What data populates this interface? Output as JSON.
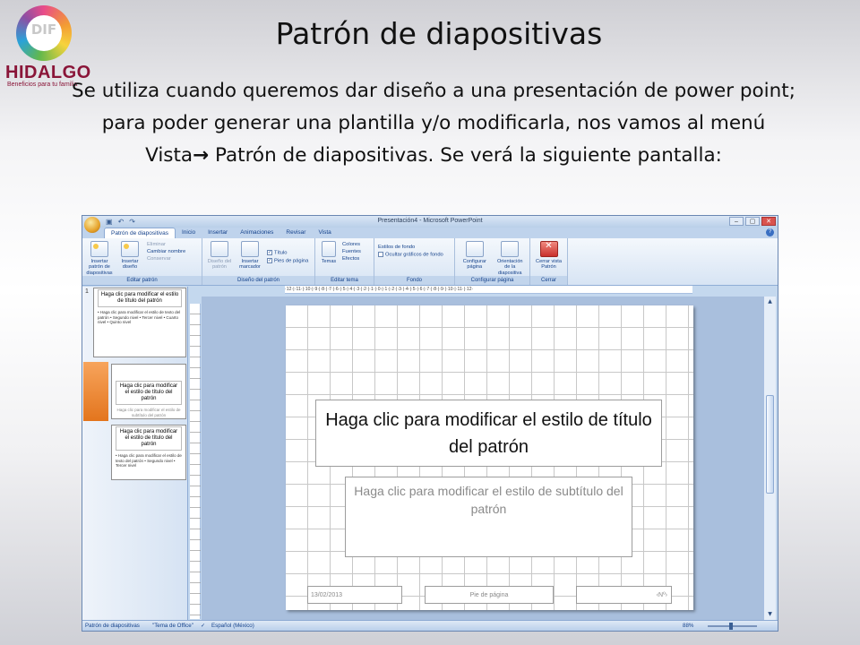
{
  "logo": {
    "mark": "DIF",
    "name": "HIDALGO",
    "tagline": "Beneficios para tu familia"
  },
  "slide_title": "Patrón de diapositivas",
  "intro": {
    "before_arrow": "Se utiliza cuando queremos dar diseño a una presentación de power point; para poder generar una plantilla y/o modificarla, nos vamos al menú Vista",
    "arrow": "→",
    "after_arrow": " Patrón de diapositivas. Se verá la siguiente pantalla:"
  },
  "app": {
    "window_title": "Presentación4 - Microsoft PowerPoint",
    "window_controls": [
      "–",
      "▢",
      "✕"
    ],
    "tabs": [
      "Patrón de diapositivas",
      "Inicio",
      "Insertar",
      "Animaciones",
      "Revisar",
      "Vista"
    ],
    "ribbon": {
      "editar_patron": {
        "label": "Editar patrón",
        "insert_master": "Insertar patrón de diapositivas",
        "insert_layout": "Insertar diseño",
        "delete": "Eliminar",
        "rename": "Cambiar nombre",
        "preserve": "Conservar"
      },
      "diseno_patron": {
        "label": "Diseño del patrón",
        "master_layout": "Diseño del patrón",
        "insert_placeholder": "Insertar marcador",
        "title_check": "Título",
        "footer_check": "Pies de página"
      },
      "editar_tema": {
        "label": "Editar tema",
        "themes": "Temas",
        "colors": "Colores",
        "fonts": "Fuentes",
        "effects": "Efectos"
      },
      "fondo": {
        "label": "Fondo",
        "bg_styles": "Estilos de fondo",
        "hide_bg": "Ocultar gráficos de fondo"
      },
      "configurar_pagina": {
        "label": "Configurar página",
        "page_setup": "Configurar página",
        "orientation": "Orientación de la diapositiva"
      },
      "cerrar": {
        "label": "Cerrar",
        "close_view": "Cerrar vista Patrón"
      }
    },
    "thumbnails": {
      "num": "1",
      "t1_title": "Haga clic para modificar el estilo de título del patrón",
      "t1_body": "• Haga clic para modificar el estilo de texto del patrón • Segundo nivel • Tercer nivel • Cuarto nivel • Quinto nivel",
      "t2_title": "Haga clic para modificar el estilo de título del patrón",
      "t2_sub": "Haga clic para modificar el estilo de subtítulo del patrón",
      "t3_title": "Haga clic para modificar el estilo de título del patrón",
      "t3_body": "• Haga clic para modificar el estilo de texto del patrón • Segundo nivel • Tercer nivel"
    },
    "ruler_text": "·12·|·11·|·10·|·9·|·8·|·7·|·6·|·5·|·4·|·3·|·2·|·1·|·0·|·1·|·2·|·3·|·4·|·5·|·6·|·7·|·8·|·9·|·10·|·11·|·12·",
    "slide": {
      "title_placeholder": "Haga clic para modificar el estilo de título del patrón",
      "subtitle_placeholder": "Haga clic para modificar el estilo de subtítulo del patrón",
      "date": "13/02/2013",
      "footer": "Pie de página",
      "number": "‹Nº›"
    },
    "status": {
      "view": "Patrón de diapositivas",
      "theme": "\"Tema de Office\"",
      "language": "Español (México)",
      "zoom": "88%"
    }
  }
}
